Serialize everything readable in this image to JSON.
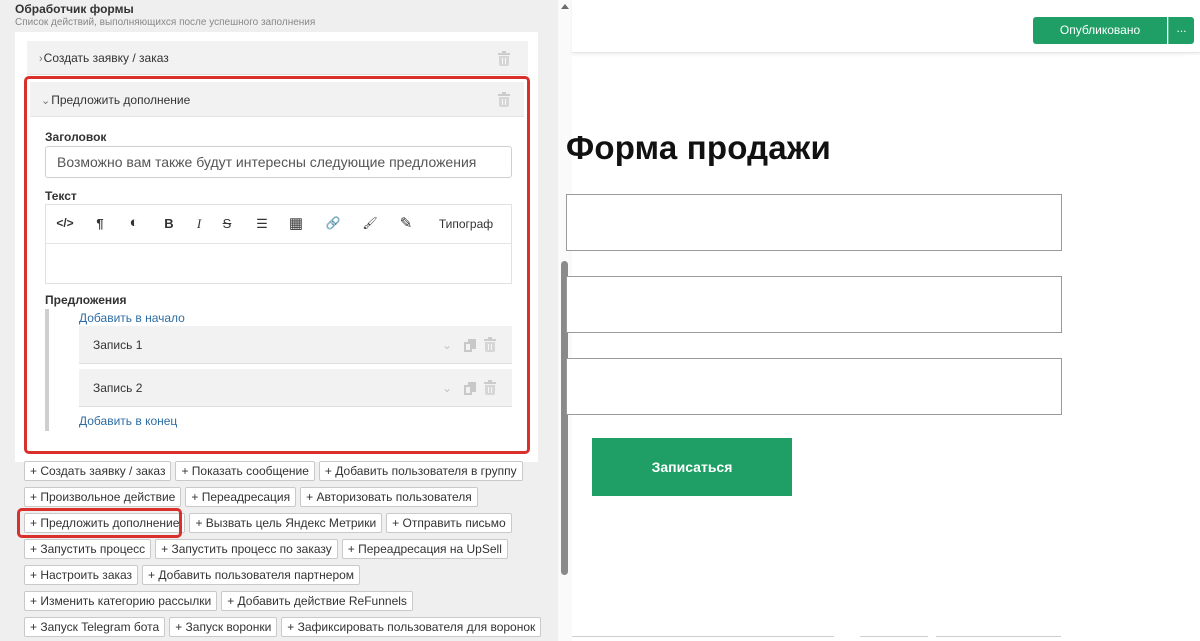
{
  "panel": {
    "title": "Обработчик формы",
    "subtitle": "Список действий, выполняющихся после успешного заполнения",
    "accordion_collapsed": {
      "label": "Создать заявку / заказ"
    },
    "accordion_open": {
      "label": "Предложить дополнение",
      "title_label": "Заголовок",
      "title_value": "Возможно вам также будут интересны следующие предложения",
      "text_label": "Текст",
      "toolbar": {
        "items": [
          {
            "name": "code-icon",
            "glyph": "</>"
          },
          {
            "name": "paragraph-icon",
            "glyph": "¶"
          },
          {
            "name": "contrast-icon",
            "glyph": "◐"
          },
          {
            "name": "bold-icon",
            "glyph": "B"
          },
          {
            "name": "italic-icon",
            "glyph": "I"
          },
          {
            "name": "strikethrough-icon",
            "glyph": "S"
          },
          {
            "name": "bulleted-list-icon",
            "glyph": "☰"
          },
          {
            "name": "table-icon",
            "glyph": "▦"
          },
          {
            "name": "link-icon",
            "glyph": "🔗"
          },
          {
            "name": "brush-icon",
            "glyph": "🖌"
          },
          {
            "name": "pencil-icon",
            "glyph": "✎"
          }
        ],
        "typograph_label": "Типограф"
      },
      "offers_label": "Предложения",
      "add_to_start": "Добавить в начало",
      "records": [
        {
          "label": "Запись 1"
        },
        {
          "label": "Запись 2"
        }
      ],
      "add_to_end": "Добавить в конец"
    }
  },
  "add_actions": {
    "rows": [
      [
        "+ Создать заявку / заказ",
        "+ Показать сообщение",
        "+ Добавить пользователя в группу"
      ],
      [
        "+ Произвольное действие",
        "+ Переадресация",
        "+ Авторизовать пользователя"
      ],
      [
        "+ Предложить дополнение",
        "+ Вызвать цель Яндекс Метрики",
        "+ Отправить письмо"
      ],
      [
        "+ Запустить процесс",
        "+ Запустить процесс по заказу",
        "+ Переадресация на UpSell"
      ],
      [
        "+ Настроить заказ",
        "+ Добавить пользователя партнером"
      ],
      [
        "+ Изменить категорию рассылки",
        "+ Добавить действие ReFunnels"
      ],
      [
        "+ Запуск Telegram бота",
        "+ Запуск воронки",
        "+ Зафиксировать пользователя для воронок"
      ]
    ]
  },
  "header": {
    "publish_label": "Опубликовано",
    "more_label": "..."
  },
  "preview": {
    "form_title": "Форма продажи",
    "submit_label": "Записаться"
  },
  "colors": {
    "accent_green": "#1f9f66",
    "highlight_red": "#d9302c",
    "link_blue": "#2e6da4"
  }
}
